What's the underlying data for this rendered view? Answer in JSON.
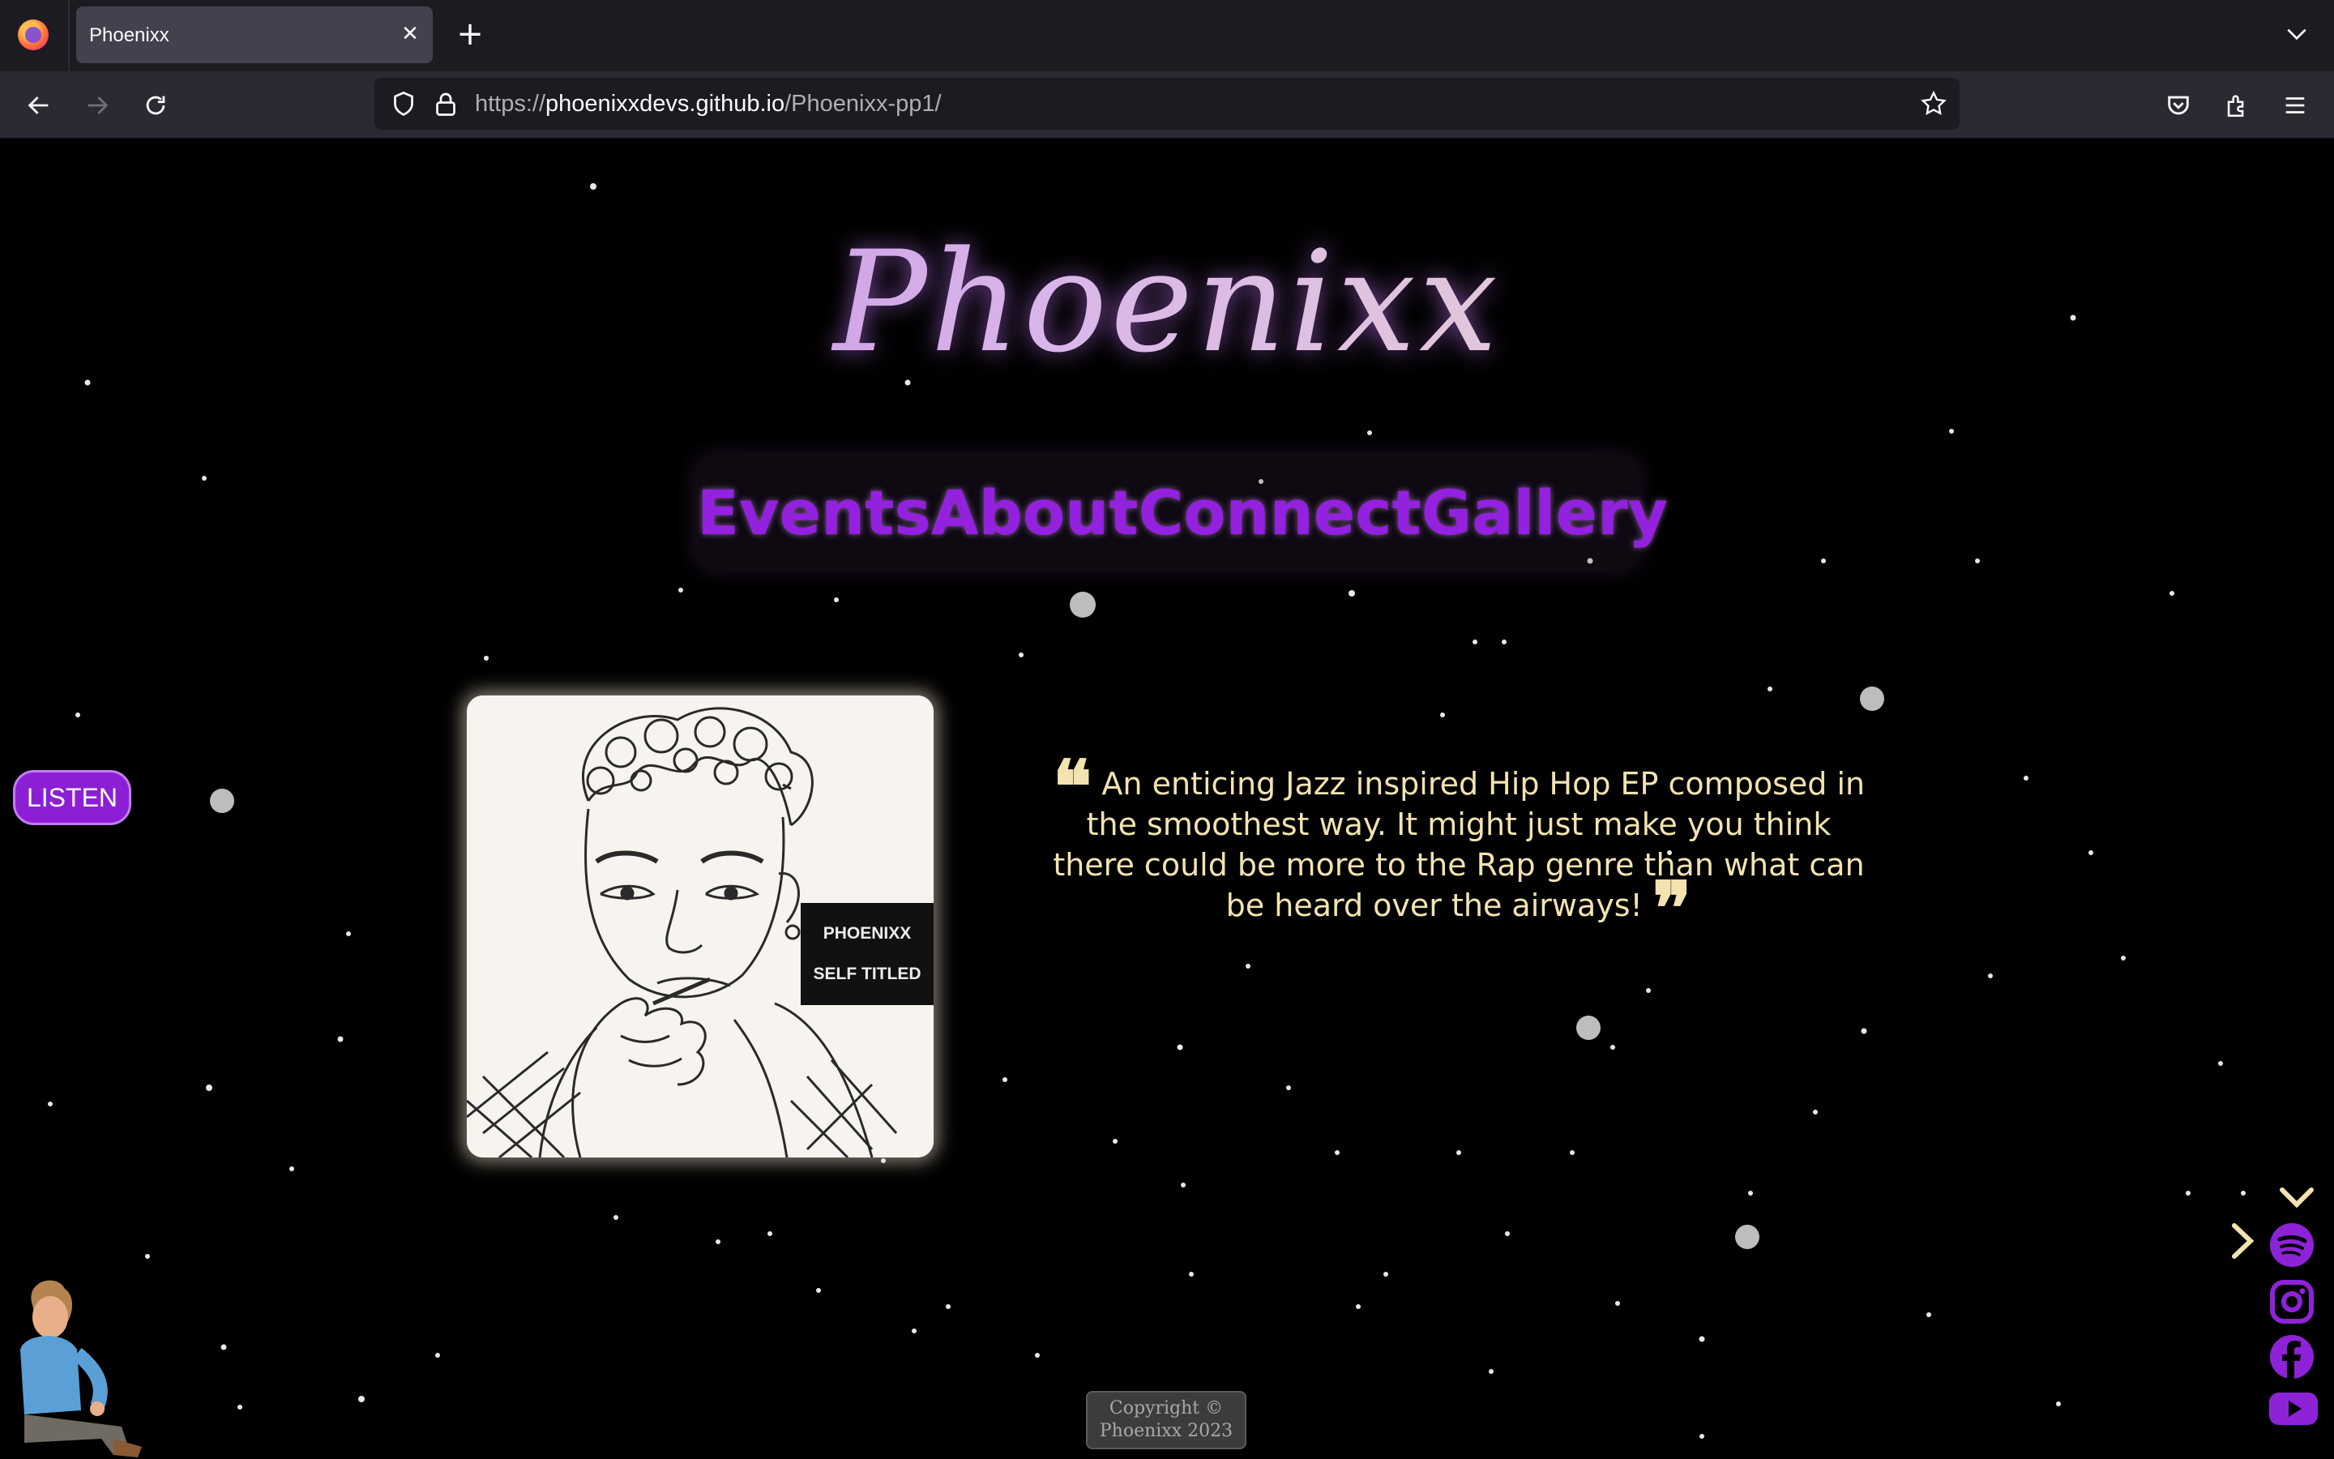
{
  "browser": {
    "tab_title": "Phoenixx",
    "url_prefix": "https://",
    "url_host": "phoenixxdevs.github.io",
    "url_path": "/Phoenixx-pp1/"
  },
  "site": {
    "logo": "Phoenixx",
    "nav": [
      "Events",
      "About",
      "Connect",
      "Gallery"
    ],
    "listen_button": "LISTEN",
    "album": {
      "line1": "PHOENIXX",
      "line2": "SELF TITLED"
    },
    "quote": "An enticing Jazz inspired Hip Hop EP composed in the smoothest way. It might just make you think there could be more to the Rap genre than what can be heard over the airways!",
    "copyright_line1": "Copyright ©",
    "copyright_line2": "Phoenixx 2023"
  },
  "icons": {
    "social": [
      "spotify-icon",
      "instagram-icon",
      "facebook-icon",
      "youtube-icon"
    ],
    "arrows": [
      "chevron-down-icon",
      "chevron-right-icon"
    ]
  },
  "colors": {
    "nav": "#9420e0",
    "quote": "#f2e3b0",
    "listen_bg": "#8c1fd6",
    "social": "#8e22d8",
    "browser_tabbar": "#1c1b22",
    "browser_navbar": "#2b2a33"
  }
}
